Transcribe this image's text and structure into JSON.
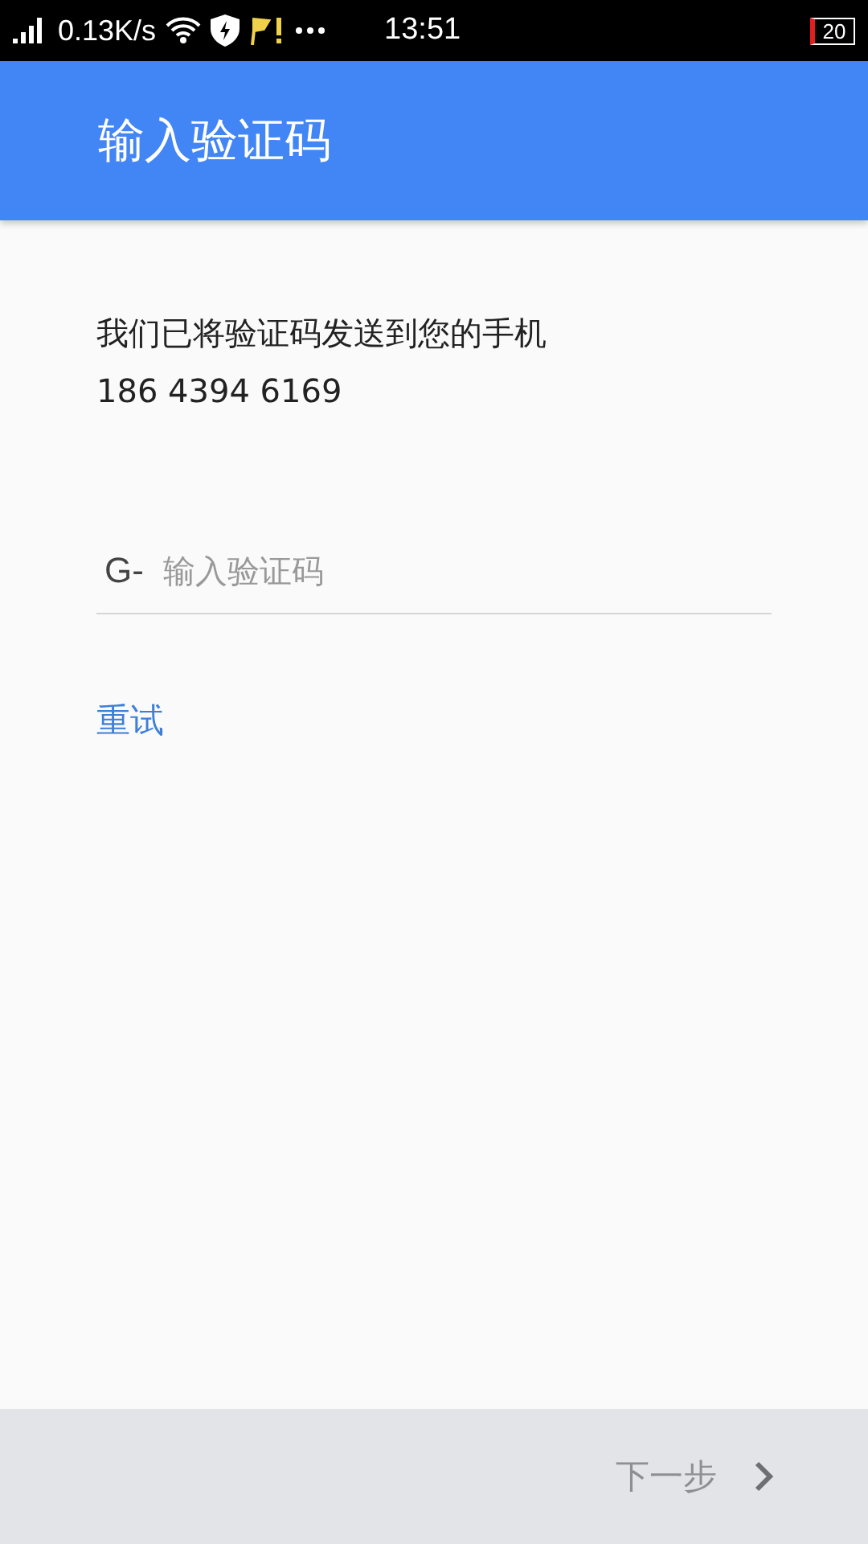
{
  "status_bar": {
    "speed": "0.13K/s",
    "time": "13:51",
    "battery": "20"
  },
  "app_bar": {
    "title": "输入验证码"
  },
  "message": {
    "line": "我们已将验证码发送到您的手机",
    "phone": "186 4394 6169"
  },
  "code_field": {
    "prefix": "G-",
    "placeholder": "输入验证码"
  },
  "retry_link": "重试",
  "next_button": {
    "label": "下一步",
    "disabled": true
  }
}
